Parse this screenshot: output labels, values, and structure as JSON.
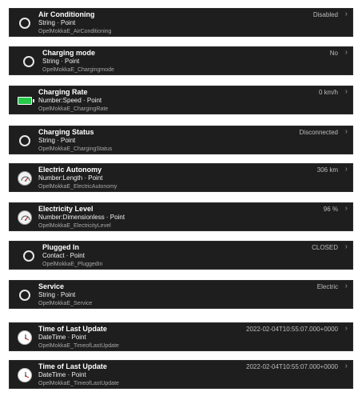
{
  "items": [
    {
      "title": "Air Conditioning",
      "type": "String · Point",
      "name": "OpelMokkaE_AirConditioning",
      "value": "Disabled",
      "icon": "circle-icon"
    },
    {
      "title": "Charging mode",
      "type": "String · Point",
      "name": "OpelMokkaE_Chargingmode",
      "value": "No",
      "icon": "circle-icon"
    },
    {
      "title": "Charging Rate",
      "type": "Number:Speed · Point",
      "name": "OpelMokkaE_ChargingRate",
      "value": "0 km/h",
      "icon": "battery-icon"
    },
    {
      "title": "Charging Status",
      "type": "String · Point",
      "name": "OpelMokkaE_ChargingStatus",
      "value": "Disconnected",
      "icon": "circle-icon"
    },
    {
      "title": "Electric Autonomy",
      "type": "Number:Length · Point",
      "name": "OpelMokkaE_ElectricAutonomy",
      "value": "306 km",
      "icon": "gauge-icon"
    },
    {
      "title": "Electricity Level",
      "type": "Number:Dimensionless · Point",
      "name": "OpelMokkaE_ElectricityLevel",
      "value": "96 %",
      "icon": "gauge-icon"
    },
    {
      "title": "Plugged In",
      "type": "Contact · Point",
      "name": "OpelMokkaE_PluggedIn",
      "value": "CLOSED",
      "icon": "circle-icon"
    },
    {
      "title": "Service",
      "type": "String · Point",
      "name": "OpelMokkaE_Service",
      "value": "Electric",
      "icon": "circle-icon"
    },
    {
      "title": "Time of Last Update",
      "type": "DateTime · Point",
      "name": "OpelMokkaE_TimeofLastUpdate",
      "value": "2022-02-04T10:55:07.000+0000",
      "icon": "clock-icon"
    },
    {
      "title": "Time of Last Update",
      "type": "DateTime · Point",
      "name": "OpelMokkaE_TimeofLastUpdate",
      "value": "2022-02-04T10:55:07.000+0000",
      "icon": "clock-icon"
    }
  ],
  "chevron": "›"
}
